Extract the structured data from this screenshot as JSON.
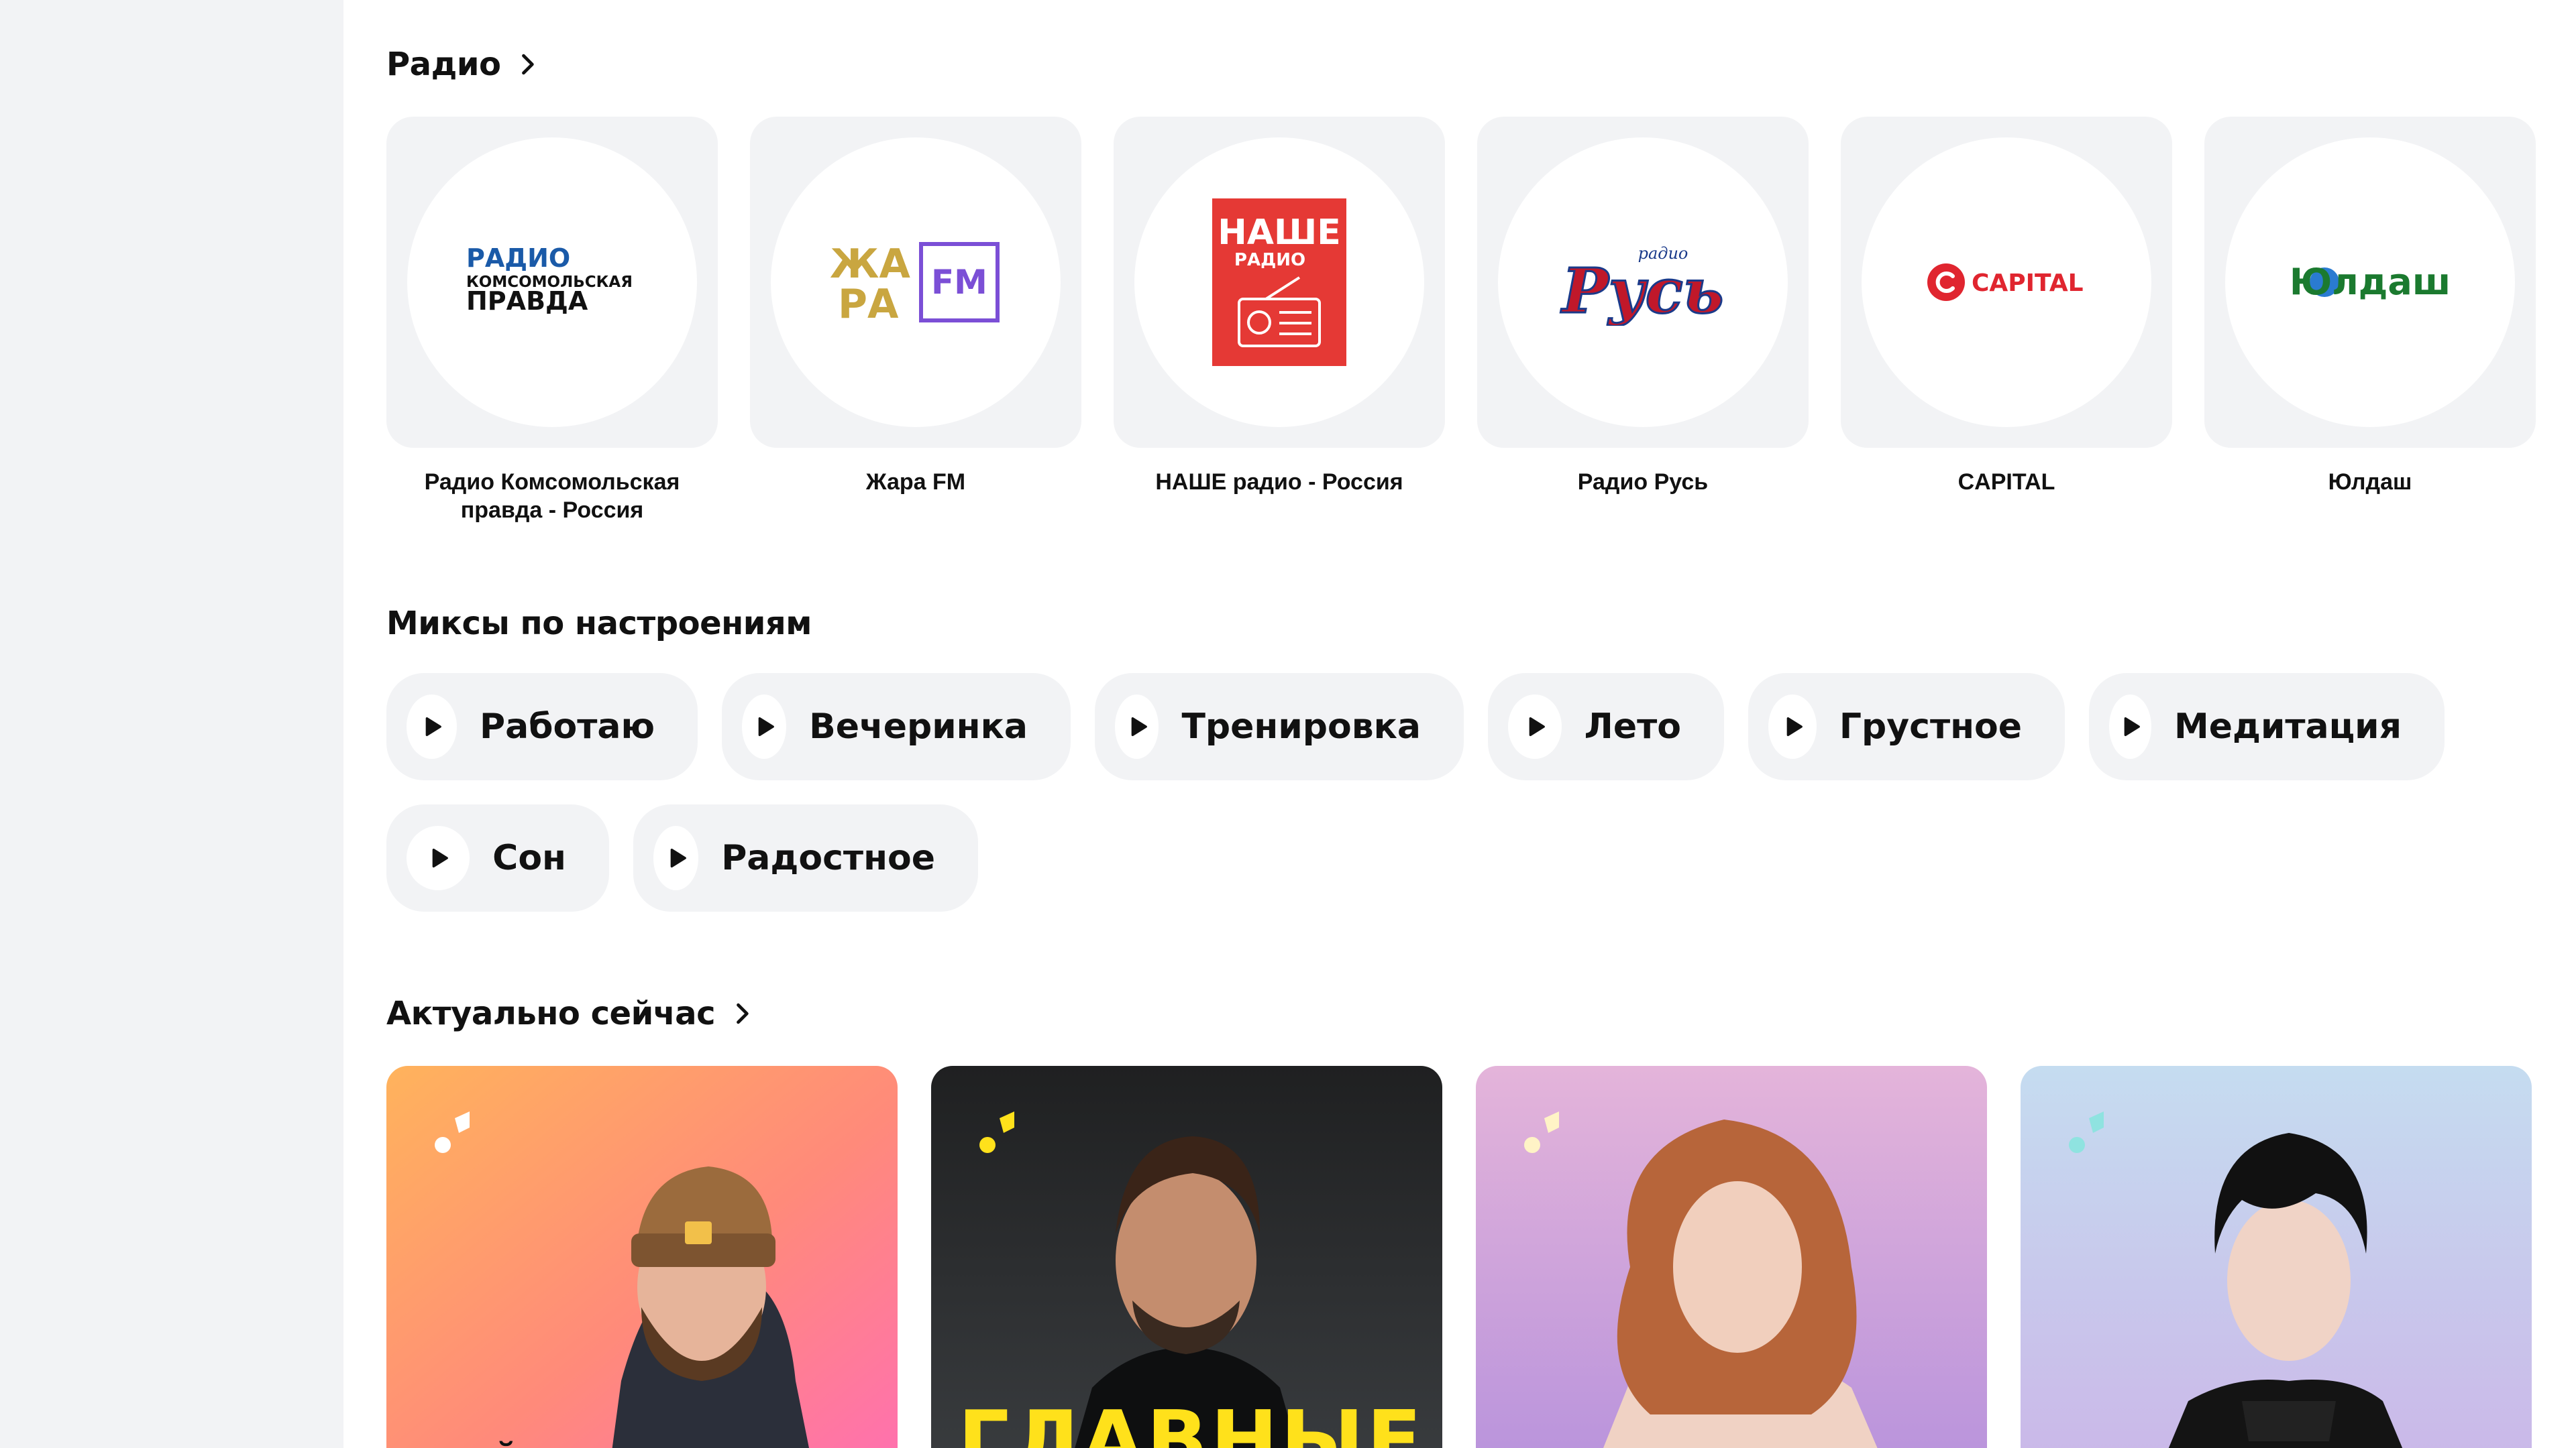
{
  "sections": {
    "radio": {
      "title": "Радио"
    },
    "moods": {
      "title": "Миксы по настроениям"
    },
    "actual": {
      "title": "Актуально сейчас"
    }
  },
  "radio_stations": [
    {
      "name": "Радио Комсомольская правда - Россия",
      "logo_lines": [
        "РАДИО",
        "КОМСОМОЛЬСКАЯ",
        "ПРАВДА"
      ]
    },
    {
      "name": "Жара FM",
      "logo_lines": [
        "ЖА",
        "РА",
        "FM"
      ]
    },
    {
      "name": "НАШЕ радио - Россия",
      "logo_lines": [
        "НАШЕ",
        "РАДИО"
      ]
    },
    {
      "name": "Радио Русь",
      "logo_lines": [
        "радио",
        "Русь"
      ]
    },
    {
      "name": "CAPITAL",
      "logo_lines": [
        "CAPITAL"
      ]
    },
    {
      "name": "Юлдаш",
      "logo_lines": [
        "Юлдаш"
      ]
    }
  ],
  "moods": [
    {
      "label": "Работаю"
    },
    {
      "label": "Вечеринка"
    },
    {
      "label": "Тренировка"
    },
    {
      "label": "Лето"
    },
    {
      "label": "Грустное"
    },
    {
      "label": "Медитация"
    },
    {
      "label": "Сон"
    },
    {
      "label": "Радостное"
    }
  ],
  "actual_cards": [
    {
      "caption": "МАЙ ТОП"
    },
    {
      "caption": "ГЛАВНЫЕ"
    },
    {
      "caption": ""
    },
    {
      "caption": ""
    }
  ],
  "colors": {
    "sidebar_bg": "#f2f3f5",
    "tile_bg": "#f2f3f5",
    "kp_blue": "#1a5aa8",
    "zhara_gold": "#c9a640",
    "zhara_purple": "#7b4fd6",
    "nashe_red": "#e53935",
    "rus_red": "#c0182a",
    "capital_red": "#e0252f",
    "yuldash_green": "#1b7a2f",
    "card_yellow": "#ffe11b"
  },
  "icons": {
    "section_link": "chevron-right-icon",
    "mood_play": "play-icon",
    "card_badge": "music-notes-icon"
  }
}
